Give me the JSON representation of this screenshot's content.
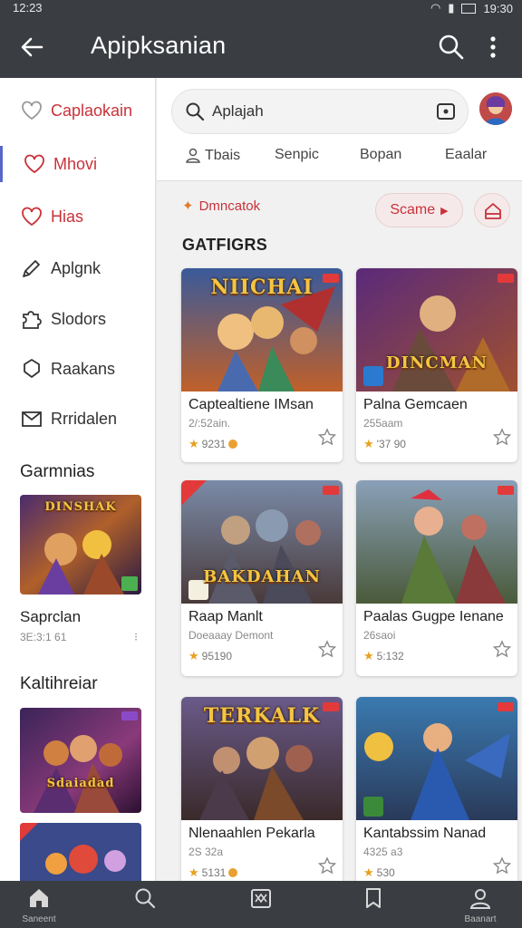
{
  "status": {
    "time_left": "12:23",
    "time_right": "19:30"
  },
  "appbar": {
    "title": "Apipksanian"
  },
  "sidebar": {
    "items": [
      {
        "label": "Caplaokain",
        "icon": "heart-outline-icon"
      },
      {
        "label": "Mhovi",
        "icon": "heart-outline-icon"
      },
      {
        "label": "Hias",
        "icon": "heart-outline-icon"
      },
      {
        "label": "Aplgnk",
        "icon": "pencil-icon"
      },
      {
        "label": "Slodors",
        "icon": "puzzle-icon"
      },
      {
        "label": "Raakans",
        "icon": "shield-icon"
      },
      {
        "label": "Rrridalen",
        "icon": "envelope-icon"
      }
    ],
    "section1": "Garmnias",
    "game1": {
      "name": "Saprclan",
      "meta": "3E:3:1 61",
      "dots": "⁝"
    },
    "section2": "Kaltihreiar"
  },
  "search": {
    "query": "Aplajah"
  },
  "chips": [
    "Tbais",
    "Senpic",
    "Bopan",
    "Eaalar"
  ],
  "promo": {
    "label": "Dmncatok"
  },
  "score_button": {
    "label": "Scame"
  },
  "section_title": "GATFIGRS",
  "cards": [
    {
      "name": "Captealtiene IMsan",
      "sub": "2/:52ain.",
      "rating": "9231",
      "thumb_title": "NIICHAI",
      "icon": "game-art"
    },
    {
      "name": "Palna Gemcaen",
      "sub": "255aam",
      "rating": "'37 90",
      "thumb_title": "DINCMAN",
      "icon": "game-art"
    },
    {
      "name": "Raap Manlt",
      "sub": "Doeaaay Demont",
      "rating": "95190",
      "thumb_title": "BAKDAHAN",
      "icon": "game-art"
    },
    {
      "name": "Paalas Gugpe Ienane",
      "sub": "26saoi",
      "rating": "5:132",
      "thumb_title": "",
      "icon": "game-art"
    },
    {
      "name": "Nlenaahlen Pekarla",
      "sub": "2S 32a",
      "rating": "5131",
      "thumb_title": "TERKALK",
      "icon": "game-art"
    },
    {
      "name": "Kantabssim Nanad",
      "sub": "4325 a3",
      "rating": "530",
      "thumb_title": "",
      "icon": "game-art"
    }
  ],
  "side_thumbs": [
    {
      "title": "DINSHAK"
    },
    {
      "title": "Sdaiadad"
    }
  ],
  "bottom_nav": [
    {
      "label": "Saneent",
      "icon": "home-icon"
    },
    {
      "label": "",
      "icon": "search-icon"
    },
    {
      "label": "",
      "icon": "box-icon"
    },
    {
      "label": "",
      "icon": "bookmark-icon"
    },
    {
      "label": "Baanart",
      "icon": "profile-icon"
    }
  ],
  "colors": {
    "bar": "#3a3d42",
    "accent": "#c8323a",
    "active": "#5a66c8"
  }
}
